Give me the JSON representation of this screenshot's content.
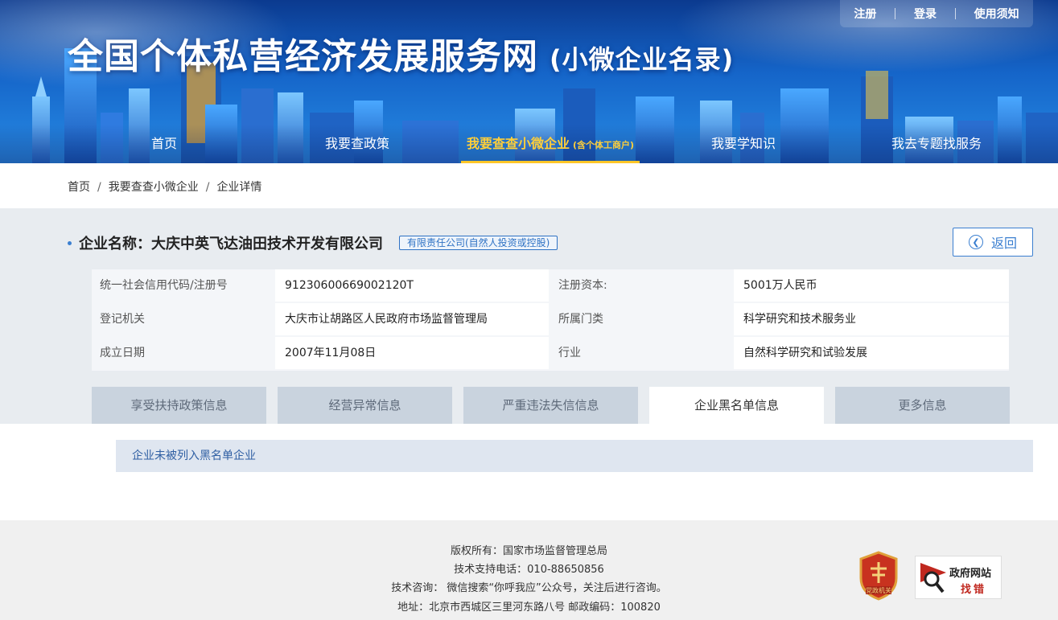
{
  "header": {
    "site_title": "全国个体私营经济发展服务网",
    "site_subtitle": "(小微企业名录)",
    "top_links": [
      "注册",
      "登录",
      "使用须知"
    ],
    "nav": [
      {
        "label": "首页",
        "note": ""
      },
      {
        "label": "我要查政策",
        "note": ""
      },
      {
        "label": "我要查查小微企业",
        "note": "(含个体工商户)"
      },
      {
        "label": "我要学知识",
        "note": ""
      },
      {
        "label": "我去专题找服务",
        "note": ""
      }
    ],
    "active_nav": "我要查查小微企业",
    "accent_color": "#ffc628"
  },
  "breadcrumb": [
    "首页",
    "我要查查小微企业",
    "企业详情"
  ],
  "company": {
    "label": "企业名称：",
    "name": "大庆中英飞达油田技术开发有限公司",
    "type_tag": "有限责任公司(自然人投资或控股)",
    "back_label": "返回"
  },
  "info": [
    {
      "k1": "统一社会信用代码/注册号",
      "v1": "91230600669002120T",
      "k2": "注册资本:",
      "v2": "5001万人民币"
    },
    {
      "k1": "登记机关",
      "v1": "大庆市让胡路区人民政府市场监督管理局",
      "k2": "所属门类",
      "v2": "科学研究和技术服务业"
    },
    {
      "k1": "成立日期",
      "v1": "2007年11月08日",
      "k2": "行业",
      "v2": "自然科学研究和试验发展"
    }
  ],
  "tabs": [
    "享受扶持政策信息",
    "经营异常信息",
    "严重违法失信信息",
    "企业黑名单信息",
    "更多信息"
  ],
  "active_tab": "企业黑名单信息",
  "notice": "企业未被列入黑名单企业",
  "footer": {
    "lines": [
      "版权所有：国家市场监督管理总局",
      "技术支持电话：010-88650856",
      "技术咨询： 微信搜索“你呼我应”公众号，关注后进行咨询。",
      "地址：北京市西城区三里河东路八号 邮政编码：100820"
    ],
    "badge_text": "党政机关",
    "zhaocuo_line1": "政府网站",
    "zhaocuo_line2": "找错"
  }
}
